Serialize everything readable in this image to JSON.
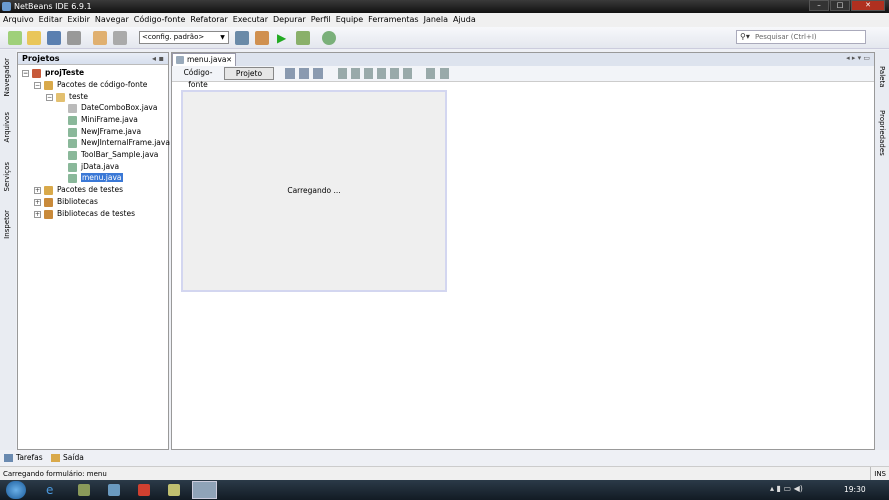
{
  "window": {
    "title": "NetBeans IDE 6.9.1"
  },
  "menu": [
    "Arquivo",
    "Editar",
    "Exibir",
    "Navegar",
    "Código-fonte",
    "Refatorar",
    "Executar",
    "Depurar",
    "Perfil",
    "Equipe",
    "Ferramentas",
    "Janela",
    "Ajuda"
  ],
  "toolbar": {
    "config": "<config. padrão>",
    "search_placeholder": "Pesquisar (Ctrl+I)"
  },
  "left_tabs": [
    "Navegador",
    "Arquivos",
    "Serviços",
    "Inspetor"
  ],
  "right_tabs": [
    "Paleta",
    "Propriedades"
  ],
  "projects": {
    "title": "Projetos",
    "root": "projTeste",
    "source": "Pacotes de código-fonte",
    "package": "teste",
    "files": [
      "DateComboBox.java",
      "MiniFrame.java",
      "NewJFrame.java",
      "NewJInternalFrame.java",
      "ToolBar_Sample.java",
      "jData.java",
      "menu.java"
    ],
    "others": [
      "Pacotes de testes",
      "Bibliotecas",
      "Bibliotecas de testes"
    ]
  },
  "editor": {
    "tab": "menu.java",
    "source_btn": "Código-fonte",
    "design_btn": "Projeto",
    "loading": "Carregando ..."
  },
  "bottom_tabs": [
    "Tarefas",
    "Saída"
  ],
  "status": {
    "message": "Carregando formulário: menu",
    "mode": "INS"
  },
  "taskbar": {
    "clock": "19:30"
  }
}
